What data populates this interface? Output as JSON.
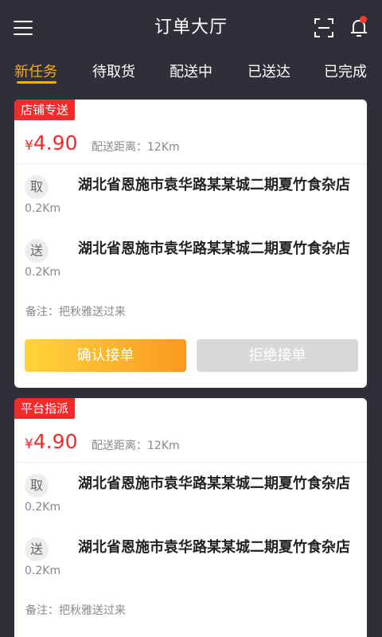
{
  "header": {
    "title": "订单大厅"
  },
  "tabs": [
    {
      "label": "新任务"
    },
    {
      "label": "待取货"
    },
    {
      "label": "配送中"
    },
    {
      "label": "已送达"
    },
    {
      "label": "已完成"
    }
  ],
  "orders": [
    {
      "badge": "店铺专送",
      "currency": "¥",
      "price": "4.90",
      "distance": "配送距离：12Km",
      "pickup": {
        "tag": "取",
        "dist": "0.2Km",
        "address": "湖北省恩施市袁华路某某城二期夏竹食杂店"
      },
      "delivery": {
        "tag": "送",
        "dist": "0.2Km",
        "address": "湖北省恩施市袁华路某某城二期夏竹食杂店"
      },
      "remark": "备注：把秋雅送过来",
      "accept_label": "确认接单",
      "reject_label": "拒绝接单"
    },
    {
      "badge": "平台指派",
      "currency": "¥",
      "price": "4.90",
      "distance": "配送距离：12Km",
      "pickup": {
        "tag": "取",
        "dist": "0.2Km",
        "address": "湖北省恩施市袁华路某某城二期夏竹食杂店"
      },
      "delivery": {
        "tag": "送",
        "dist": "0.2Km",
        "address": "湖北省恩施市袁华路某某城二期夏竹食杂店"
      },
      "remark": "备注：把秋雅送过来"
    }
  ],
  "colors": {
    "accent": "#f7a81b",
    "price": "#f52b2b",
    "background": "#2f2f3a"
  }
}
